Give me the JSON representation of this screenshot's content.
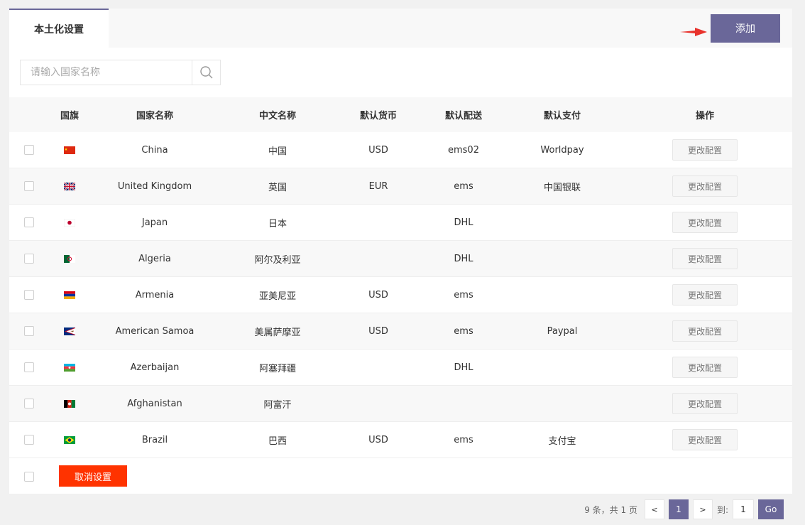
{
  "tab": {
    "label": "本土化设置"
  },
  "toolbar": {
    "add_label": "添加"
  },
  "search": {
    "placeholder": "请输入国家名称"
  },
  "table": {
    "headers": [
      "国旗",
      "国家名称",
      "中文名称",
      "默认货币",
      "默认配送",
      "默认支付",
      "操作"
    ],
    "rows": [
      {
        "flag": "china-flag-icon",
        "name": "China",
        "cn": "中国",
        "currency": "USD",
        "shipping": "ems02",
        "payment": "Worldpay",
        "action": "更改配置"
      },
      {
        "flag": "uk-flag-icon",
        "name": "United Kingdom",
        "cn": "英国",
        "currency": "EUR",
        "shipping": "ems",
        "payment": "中国银联",
        "action": "更改配置"
      },
      {
        "flag": "japan-flag-icon",
        "name": "Japan",
        "cn": "日本",
        "currency": "",
        "shipping": "DHL",
        "payment": "",
        "action": "更改配置"
      },
      {
        "flag": "algeria-flag-icon",
        "name": "Algeria",
        "cn": "阿尔及利亚",
        "currency": "",
        "shipping": "DHL",
        "payment": "",
        "action": "更改配置"
      },
      {
        "flag": "armenia-flag-icon",
        "name": "Armenia",
        "cn": "亚美尼亚",
        "currency": "USD",
        "shipping": "ems",
        "payment": "",
        "action": "更改配置"
      },
      {
        "flag": "american-samoa-flag-icon",
        "name": "American Samoa",
        "cn": "美属萨摩亚",
        "currency": "USD",
        "shipping": "ems",
        "payment": "Paypal",
        "action": "更改配置"
      },
      {
        "flag": "azerbaijan-flag-icon",
        "name": "Azerbaijan",
        "cn": "阿塞拜疆",
        "currency": "",
        "shipping": "DHL",
        "payment": "",
        "action": "更改配置"
      },
      {
        "flag": "afghanistan-flag-icon",
        "name": "Afghanistan",
        "cn": "阿富汗",
        "currency": "",
        "shipping": "",
        "payment": "",
        "action": "更改配置"
      },
      {
        "flag": "brazil-flag-icon",
        "name": "Brazil",
        "cn": "巴西",
        "currency": "USD",
        "shipping": "ems",
        "payment": "支付宝",
        "action": "更改配置"
      }
    ]
  },
  "footer": {
    "cancel_label": "取消设置"
  },
  "pager": {
    "info": "9 条，共 1 页",
    "prev": "<",
    "current": "1",
    "next": ">",
    "goto_label": "到:",
    "goto_value": "1",
    "go_label": "Go"
  },
  "colors": {
    "accent": "#6a6799",
    "danger": "#ff3300"
  }
}
